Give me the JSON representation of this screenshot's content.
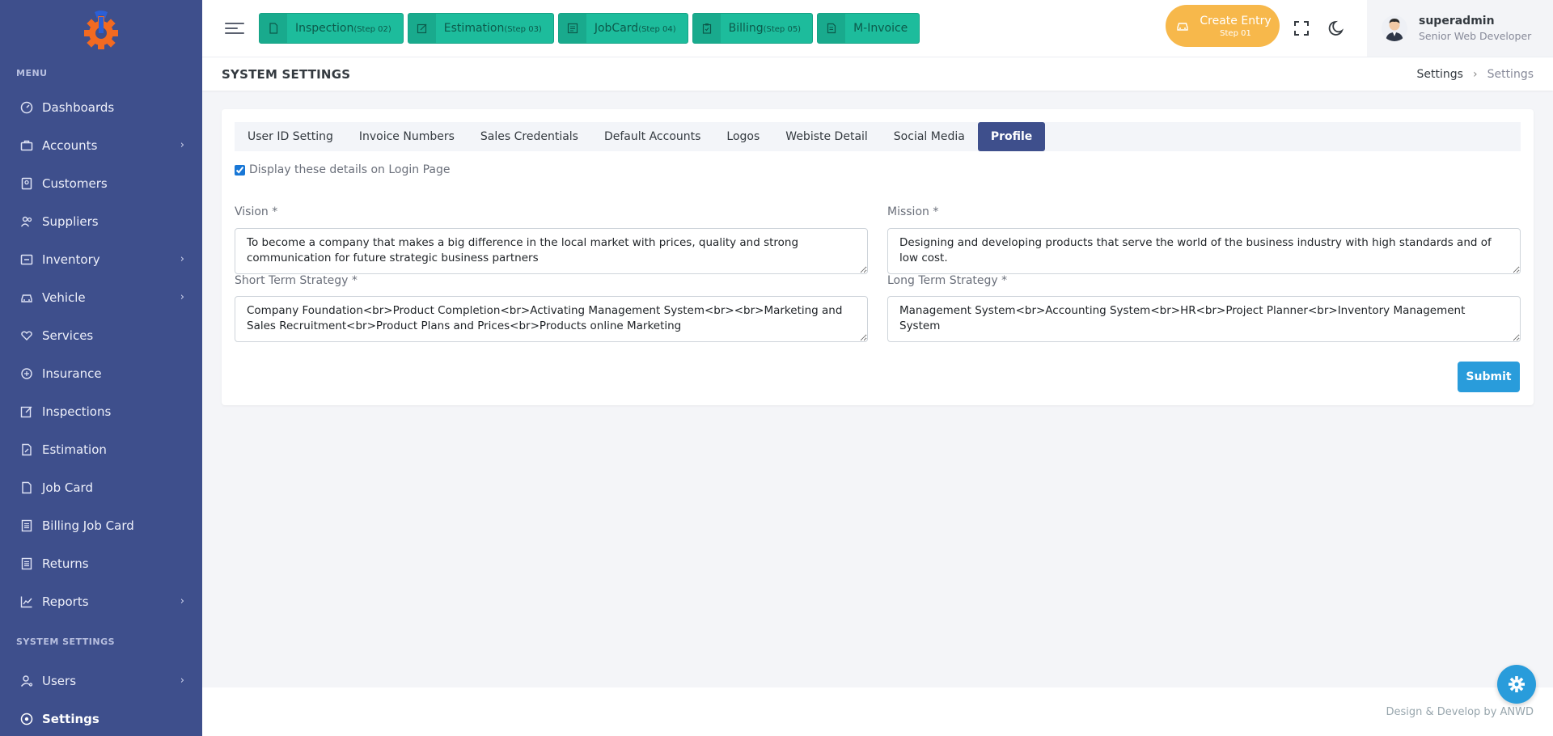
{
  "sidebar": {
    "menu_title": "MENU",
    "items": [
      {
        "label": "Dashboards",
        "icon": "dashboard-icon",
        "chevron": false
      },
      {
        "label": "Accounts",
        "icon": "briefcase-icon",
        "chevron": true
      },
      {
        "label": "Customers",
        "icon": "contact-book-icon",
        "chevron": false
      },
      {
        "label": "Suppliers",
        "icon": "users-icon",
        "chevron": false
      },
      {
        "label": "Inventory",
        "icon": "inventory-icon",
        "chevron": true
      },
      {
        "label": "Vehicle",
        "icon": "car-icon",
        "chevron": true
      },
      {
        "label": "Services",
        "icon": "heart-hand-icon",
        "chevron": false
      },
      {
        "label": "Insurance",
        "icon": "shield-icon",
        "chevron": false
      },
      {
        "label": "Inspections",
        "icon": "edit-box-icon",
        "chevron": false
      },
      {
        "label": "Estimation",
        "icon": "file-edit-icon",
        "chevron": false
      },
      {
        "label": "Job Card",
        "icon": "document-icon",
        "chevron": false
      },
      {
        "label": "Billing Job Card",
        "icon": "document-lines-icon",
        "chevron": false
      },
      {
        "label": "Returns",
        "icon": "document-lines-icon",
        "chevron": false
      },
      {
        "label": "Reports",
        "icon": "line-chart-icon",
        "chevron": true
      }
    ],
    "system_title": "SYSTEM SETTINGS",
    "system_items": [
      {
        "label": "Users",
        "icon": "user-settings-icon",
        "chevron": true
      },
      {
        "label": "Settings",
        "icon": "settings-icon",
        "chevron": false
      }
    ]
  },
  "topbar": {
    "steps": [
      {
        "label": "Inspection",
        "step": "(Step 02)",
        "icon": "file-icon"
      },
      {
        "label": "Estimation",
        "step": "(Step 03)",
        "icon": "edit-icon"
      },
      {
        "label": "JobCard",
        "step": "(Step 04)",
        "icon": "list-icon"
      },
      {
        "label": "Billing",
        "step": "(Step 05)",
        "icon": "clipboard-icon"
      },
      {
        "label": "M-Invoice",
        "step": "",
        "icon": "invoice-icon"
      }
    ],
    "create_entry": {
      "label": "Create Entry",
      "sub": "Step 01"
    },
    "user": {
      "name": "superadmin",
      "role": "Senior Web Developer"
    }
  },
  "page": {
    "title": "SYSTEM SETTINGS",
    "breadcrumb": [
      "Settings",
      "Settings"
    ]
  },
  "tabs": [
    {
      "label": "User ID Setting",
      "active": false
    },
    {
      "label": "Invoice Numbers",
      "active": false
    },
    {
      "label": "Sales Credentials",
      "active": false
    },
    {
      "label": "Default Accounts",
      "active": false
    },
    {
      "label": "Logos",
      "active": false
    },
    {
      "label": "Webiste Detail",
      "active": false
    },
    {
      "label": "Social Media",
      "active": false
    },
    {
      "label": "Profile",
      "active": true
    }
  ],
  "form": {
    "display_checkbox": {
      "label": "Display these details on Login Page",
      "checked": true
    },
    "vision": {
      "label": "Vision *",
      "value": "To become a company that makes a big difference in the local market with prices, quality and strong communication for future strategic business partners"
    },
    "mission": {
      "label": "Mission *",
      "value": "Designing and developing products that serve the world of the business industry with high standards and of low cost."
    },
    "short_term": {
      "label": "Short Term Strategy *",
      "value": "Company Foundation<br>Product Completion<br>Activating Management System<br><br>Marketing and Sales Recruitment<br>Product Plans and Prices<br>Products online Marketing"
    },
    "long_term": {
      "label": "Long Term Strategy *",
      "value": "Management System<br>Accounting System<br>HR<br>Project Planner<br>Inventory Management System"
    },
    "submit_label": "Submit"
  },
  "footer": {
    "text": "Design & Develop by ANWD"
  },
  "colors": {
    "sidebar": "#3e4f8c",
    "step_button": "#1dbc9c",
    "create_entry": "#f7b84b",
    "primary": "#299cdb",
    "tab_active": "#3e4f8c"
  }
}
